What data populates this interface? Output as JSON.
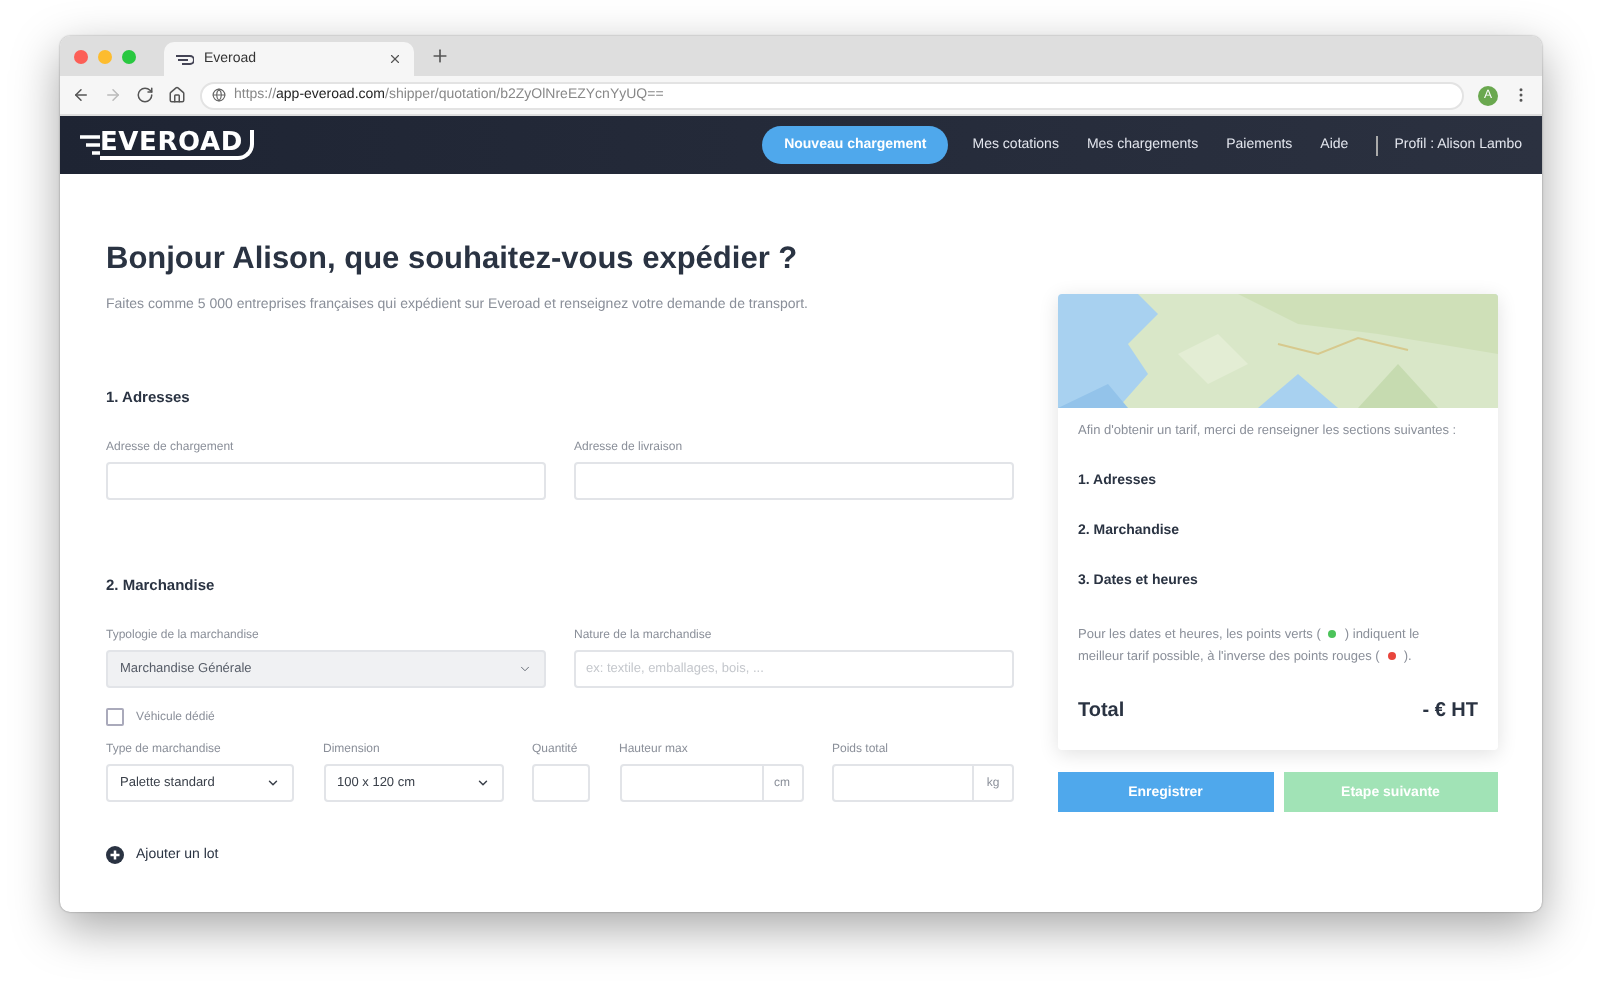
{
  "browser": {
    "tab_title": "Everoad",
    "url_scheme": "https://",
    "url_host": "app-everoad.com",
    "url_path": "/shipper/quotation/b2ZyOlNreEZYcnYyUQ==",
    "forward_disabled": true,
    "avatar": "A"
  },
  "nav": {
    "logo": "EVEROAD",
    "cta": "Nouveau chargement",
    "links": [
      {
        "label": "Mes cotations"
      },
      {
        "label": "Mes chargements"
      },
      {
        "label": "Paiements"
      },
      {
        "label": "Aide"
      }
    ],
    "profile": "Profil : Alison Lambo"
  },
  "heading": "Bonjour Alison, que souhaitez-vous expédier ?",
  "subtitle": "Faites comme 5 000 entreprises françaises qui expédient sur Everoad et renseignez votre demande de transport.",
  "addresses": {
    "title": "1. Adresses",
    "fields": [
      {
        "label": "Adresse de chargement",
        "kind": "text"
      },
      {
        "label": "Adresse de livraison",
        "kind": "text"
      }
    ]
  },
  "goods": {
    "title": "2. Marchandise",
    "row1": [
      {
        "label": "Typologie de la marchandise",
        "kind": "select",
        "value": "Marchandise Générale",
        "disabled": true
      },
      {
        "label": "Nature de la marchandise",
        "kind": "text",
        "placeholder": "ex: textile, emballages, bois, ..."
      }
    ],
    "dedicated_vehicle": {
      "label": "Véhicule dédié",
      "checked": false
    },
    "row2": [
      {
        "label": "Type de marchandise",
        "kind": "select",
        "value": "Palette standard",
        "disabled": false
      },
      {
        "label": "Dimension",
        "kind": "select",
        "value": "100 x 120 cm",
        "disabled": false
      },
      {
        "label": "Quantité",
        "kind": "text"
      },
      {
        "label": "Hauteur max",
        "kind": "unit",
        "unit": "cm"
      },
      {
        "label": "Poids total",
        "kind": "unit",
        "unit": "kg"
      }
    ],
    "add_lot": "Ajouter un lot"
  },
  "summary": {
    "map": {
      "kind": "picture"
    },
    "intro": "Afin d'obtenir un tarif, merci de renseigner les sections suivantes :",
    "steps": [
      "1. Adresses",
      "2. Marchandise",
      "3. Dates et heures"
    ],
    "hint_lines": [
      [
        {
          "kind": "text",
          "text": "Pour les dates et heures, les points verts ("
        },
        {
          "kind": "dot",
          "color": "#4cc35a"
        },
        {
          "kind": "text",
          "text": ") indiquent le"
        }
      ],
      [
        {
          "kind": "text",
          "text": "meilleur tarif possible, à l'inverse des points rouges ("
        },
        {
          "kind": "dot",
          "color": "#e8453c"
        },
        {
          "kind": "text",
          "text": ")."
        }
      ]
    ],
    "total_label": "Total",
    "total_value": "- € HT"
  },
  "buttons": [
    {
      "label": "Enregistrer",
      "kind": "save",
      "disabled": false
    },
    {
      "label": "Etape suivante",
      "kind": "next",
      "disabled": true
    }
  ]
}
